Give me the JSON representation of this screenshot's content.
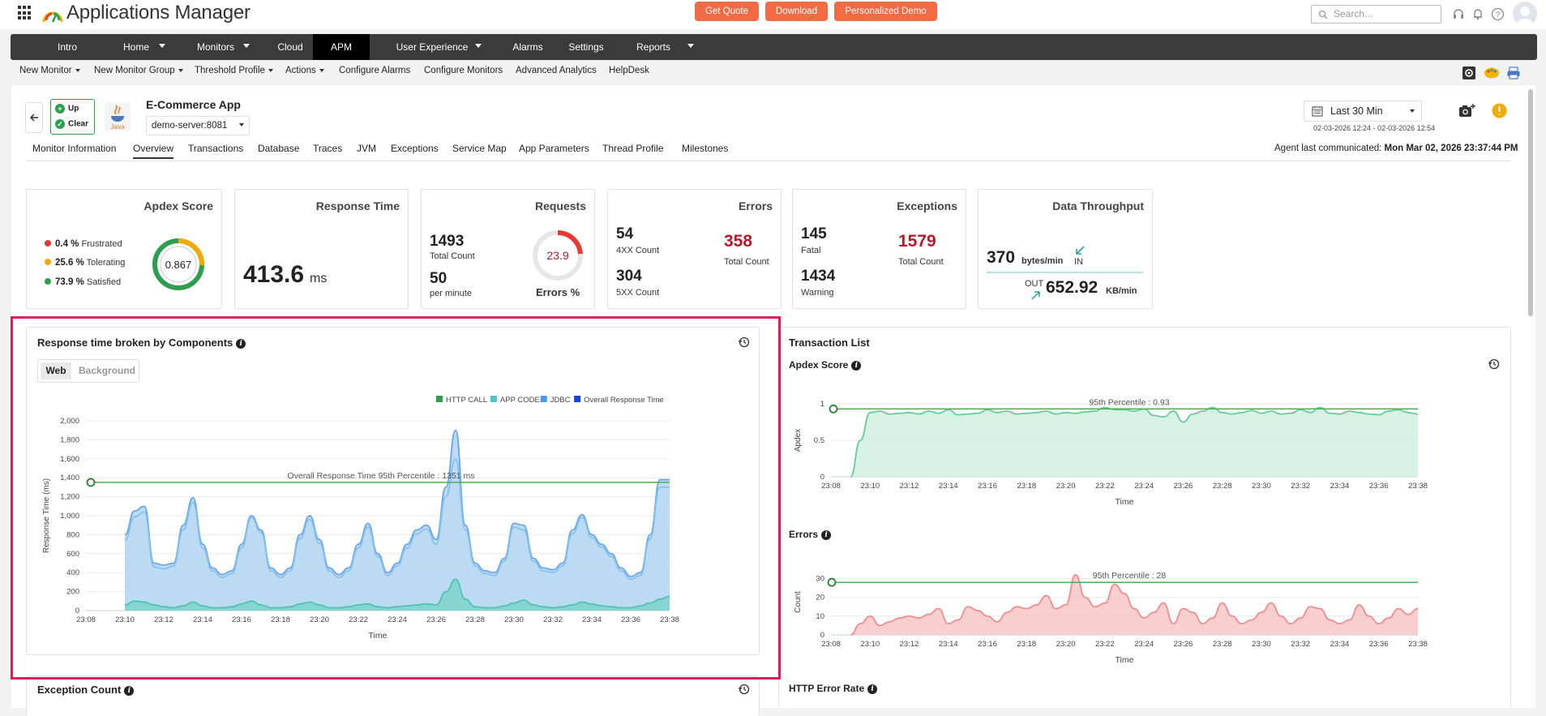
{
  "header": {
    "app_title": "Applications Manager",
    "get_quote": "Get Quote",
    "download": "Download",
    "demo": "Personalized Demo",
    "search_placeholder": "Search..."
  },
  "nav": {
    "items": [
      {
        "label": "Intro",
        "left": 0,
        "width": 140,
        "caret": false
      },
      {
        "label": "Home",
        "left": 0,
        "width": 0,
        "caret": true
      },
      {
        "label": "Monitors",
        "left": 0,
        "width": 0,
        "caret": true
      },
      {
        "label": "Cloud",
        "left": 0,
        "width": 0,
        "caret": false
      },
      {
        "label": "APM",
        "left": 0,
        "width": 0,
        "caret": false
      },
      {
        "label": "User Experience",
        "left": 0,
        "width": 0,
        "caret": true
      },
      {
        "label": "Alarms",
        "left": 0,
        "width": 0,
        "caret": false
      },
      {
        "label": "Settings",
        "left": 0,
        "width": 0,
        "caret": false
      },
      {
        "label": "Reports",
        "left": 0,
        "width": 0,
        "caret": true
      }
    ]
  },
  "subnav": [
    "New Monitor",
    "New Monitor Group",
    "Threshold Profile",
    "Actions",
    "Configure Alarms",
    "Configure Monitors",
    "Advanced Analytics",
    "HelpDesk"
  ],
  "monitor": {
    "status_up": "Up",
    "status_clear": "Clear",
    "java_label": "Java",
    "name": "E-Commerce App",
    "server": "demo-server:8081",
    "range": "Last 30 Min",
    "range_sub": "02-03-2026 12:24 - 02-03-2026 12:54",
    "agent_label": "Agent last communicated:",
    "agent_time": "Mon Mar 02, 2026 23:37:44 PM"
  },
  "tabs": [
    "Monitor Information",
    "Overview",
    "Transactions",
    "Database",
    "Traces",
    "JVM",
    "Exceptions",
    "Service Map",
    "App Parameters",
    "Thread Profile",
    "Milestones"
  ],
  "kpis": {
    "apdex": {
      "title": "Apdex Score",
      "frustrated_pct": "0.4 %",
      "frustrated": "Frustrated",
      "tolerating_pct": "25.6 %",
      "tolerating": "Tolerating",
      "satisfied_pct": "73.9 %",
      "satisfied": "Satisfied",
      "score": "0.867",
      "score_value": 0.867
    },
    "response": {
      "title": "Response Time",
      "value": "413.6",
      "unit": "ms"
    },
    "requests": {
      "title": "Requests",
      "total": "1493",
      "total_label": "Total Count",
      "per_min": "50",
      "per_min_label": "per minute",
      "errors_pct": "23.9",
      "errors_pct_value": 23.9,
      "errors_label": "Errors %"
    },
    "errors": {
      "title": "Errors",
      "c4xx": "54",
      "c4xx_label": "4XX Count",
      "c5xx": "304",
      "c5xx_label": "5XX Count",
      "total": "358",
      "total_label": "Total Count"
    },
    "exceptions": {
      "title": "Exceptions",
      "fatal": "145",
      "fatal_label": "Fatal",
      "warning": "1434",
      "warning_label": "Warning",
      "total": "1579",
      "total_label": "Total Count"
    },
    "throughput": {
      "title": "Data Throughput",
      "in_value": "370",
      "in_unit": "bytes/min",
      "in_label": "IN",
      "out_label": "OUT",
      "out_value": "652.92",
      "out_unit": "KB/min"
    }
  },
  "panels": {
    "rt_title": "Response time broken by Components",
    "seg_web": "Web",
    "seg_background": "Background",
    "tx_title": "Transaction List",
    "apdex_title": "Apdex Score",
    "errors_title": "Errors",
    "exception_title": "Exception Count",
    "http_error_title": "HTTP Error Rate"
  },
  "colors": {
    "accent": "#f26b45",
    "green": "#2e9e4e",
    "red": "#b31b2b",
    "highlight": "#e8175d"
  },
  "chart_data": [
    {
      "type": "area",
      "title": "Response time broken by Components",
      "xlabel": "Time",
      "ylabel": "Response Time (ms)",
      "ylim": [
        0,
        2000
      ],
      "yticks": [
        "0",
        "200",
        "400",
        "600",
        "800",
        "1,000",
        "1,200",
        "1,400",
        "1,600",
        "1,800",
        "2,000"
      ],
      "xticks": [
        "23:08",
        "23:10",
        "23:12",
        "23:14",
        "23:16",
        "23:18",
        "23:20",
        "23:22",
        "23:24",
        "23:26",
        "23:28",
        "23:30",
        "23:32",
        "23:34",
        "23:36",
        "23:38"
      ],
      "legend": [
        "HTTP CALL",
        "APP CODE",
        "JDBC",
        "Overall Response Time"
      ],
      "legend_colors": [
        "#2e9e4e",
        "#4ec3c9",
        "#4a9ae8",
        "#1e3fd8"
      ],
      "threshold": {
        "value": 1351,
        "label": "Overall Response Time 95th Percentile : 1351 ms"
      },
      "x": [
        10,
        10.5,
        11,
        11.5,
        12,
        12.5,
        13,
        13.5,
        14,
        14.5,
        15,
        15.5,
        16,
        16.5,
        17,
        17.5,
        18,
        18.5,
        19,
        19.5,
        20,
        20.5,
        21,
        21.5,
        22,
        22.5,
        23,
        23.5,
        24,
        24.5,
        25,
        25.5,
        26,
        26.5,
        27,
        27.5,
        28,
        28.5,
        29,
        29.5,
        30,
        30.5,
        31,
        31.5,
        32,
        32.5,
        33,
        33.5,
        34,
        34.5,
        35,
        35.5,
        36,
        36.5,
        37,
        37.5,
        38
      ],
      "series": [
        {
          "name": "Overall Response Time",
          "values": [
            800,
            1050,
            1100,
            500,
            480,
            500,
            900,
            1190,
            700,
            450,
            380,
            420,
            700,
            1000,
            850,
            450,
            380,
            450,
            800,
            1000,
            750,
            450,
            380,
            450,
            700,
            920,
            600,
            400,
            500,
            700,
            850,
            900,
            750,
            1300,
            1900,
            900,
            500,
            420,
            400,
            550,
            920,
            900,
            550,
            450,
            430,
            500,
            850,
            1010,
            800,
            700,
            600,
            450,
            360,
            400,
            800,
            1380,
            1380
          ]
        },
        {
          "name": "APP CODE",
          "values": [
            740,
            990,
            1040,
            460,
            440,
            470,
            850,
            1140,
            660,
            420,
            350,
            390,
            660,
            980,
            820,
            420,
            350,
            420,
            760,
            960,
            710,
            420,
            350,
            420,
            660,
            880,
            570,
            370,
            470,
            660,
            810,
            860,
            700,
            1200,
            1600,
            850,
            470,
            390,
            370,
            520,
            880,
            850,
            520,
            420,
            400,
            470,
            810,
            980,
            770,
            670,
            570,
            420,
            330,
            370,
            760,
            1300,
            1300
          ]
        },
        {
          "name": "HTTP CALL",
          "values": [
            60,
            100,
            90,
            60,
            40,
            30,
            50,
            90,
            50,
            30,
            30,
            40,
            70,
            100,
            60,
            30,
            30,
            40,
            70,
            90,
            60,
            30,
            30,
            40,
            60,
            70,
            40,
            30,
            40,
            50,
            60,
            70,
            60,
            200,
            330,
            120,
            40,
            30,
            30,
            50,
            80,
            110,
            60,
            40,
            30,
            40,
            60,
            90,
            70,
            50,
            40,
            30,
            30,
            50,
            80,
            120,
            150
          ]
        }
      ]
    },
    {
      "type": "area",
      "title": "Apdex Score",
      "xlabel": "Time",
      "ylabel": "Apdex",
      "ylim": [
        0,
        1
      ],
      "yticks": [
        "0",
        "0.5",
        "1"
      ],
      "xticks": [
        "23:08",
        "23:10",
        "23:12",
        "23:14",
        "23:16",
        "23:18",
        "23:20",
        "23:22",
        "23:24",
        "23:26",
        "23:28",
        "23:30",
        "23:32",
        "23:34",
        "23:36",
        "23:38"
      ],
      "threshold": {
        "value": 0.93,
        "label": "95th Percentile : 0.93"
      },
      "x": [
        9,
        9.5,
        10,
        10.5,
        11,
        11.5,
        12,
        12.5,
        13,
        13.5,
        14,
        14.5,
        15,
        15.5,
        16,
        16.5,
        17,
        17.5,
        18,
        18.5,
        19,
        19.5,
        20,
        20.5,
        21,
        21.5,
        22,
        22.5,
        23,
        23.5,
        24,
        24.5,
        25,
        25.5,
        26,
        26.5,
        27,
        27.5,
        28,
        28.5,
        29,
        29.5,
        30,
        30.5,
        31,
        31.5,
        32,
        32.5,
        33,
        33.5,
        34,
        34.5,
        35,
        35.5,
        36,
        36.5,
        37,
        37.5,
        38
      ],
      "values": [
        0,
        0.5,
        0.88,
        0.9,
        0.86,
        0.87,
        0.88,
        0.86,
        0.9,
        0.87,
        0.92,
        0.85,
        0.86,
        0.87,
        0.92,
        0.88,
        0.9,
        0.86,
        0.87,
        0.88,
        0.9,
        0.86,
        0.88,
        0.87,
        0.89,
        0.9,
        0.95,
        0.92,
        0.92,
        0.9,
        0.93,
        0.84,
        0.82,
        0.9,
        0.75,
        0.86,
        0.9,
        0.95,
        0.88,
        0.86,
        0.88,
        0.91,
        0.87,
        0.9,
        0.86,
        0.87,
        0.92,
        0.88,
        0.95,
        0.87,
        0.86,
        0.9,
        0.88,
        0.86,
        0.85,
        0.9,
        0.92,
        0.88,
        0.86
      ]
    },
    {
      "type": "area",
      "title": "Errors",
      "xlabel": "Time",
      "ylabel": "Count",
      "ylim": [
        0,
        35
      ],
      "yticks": [
        "0",
        "10",
        "20",
        "30"
      ],
      "xticks": [
        "23:08",
        "23:10",
        "23:12",
        "23:14",
        "23:16",
        "23:18",
        "23:20",
        "23:22",
        "23:24",
        "23:26",
        "23:28",
        "23:30",
        "23:32",
        "23:34",
        "23:36",
        "23:38"
      ],
      "threshold": {
        "value": 28,
        "label": "95th Percentile : 28"
      },
      "x": [
        9,
        9.5,
        10,
        10.5,
        11,
        11.5,
        12,
        12.5,
        13,
        13.5,
        14,
        14.5,
        15,
        15.5,
        16,
        16.5,
        17,
        17.5,
        18,
        18.5,
        19,
        19.5,
        20,
        20.5,
        21,
        21.5,
        22,
        22.5,
        23,
        23.5,
        24,
        24.5,
        25,
        25.5,
        26,
        26.5,
        27,
        27.5,
        28,
        28.5,
        29,
        29.5,
        30,
        30.5,
        31,
        31.5,
        32,
        32.5,
        33,
        33.5,
        34,
        34.5,
        35,
        35.5,
        36,
        36.5,
        37,
        37.5,
        38
      ],
      "values": [
        0,
        6,
        10,
        5,
        7,
        9,
        10,
        9,
        11,
        14,
        6,
        8,
        15,
        13,
        10,
        7,
        12,
        15,
        14,
        16,
        21,
        14,
        16,
        32,
        20,
        15,
        17,
        27,
        22,
        14,
        9,
        12,
        17,
        6,
        14,
        12,
        6,
        9,
        17,
        10,
        6,
        8,
        12,
        17,
        10,
        6,
        9,
        15,
        14,
        8,
        6,
        8,
        16,
        10,
        6,
        9,
        14,
        11,
        14
      ]
    }
  ]
}
